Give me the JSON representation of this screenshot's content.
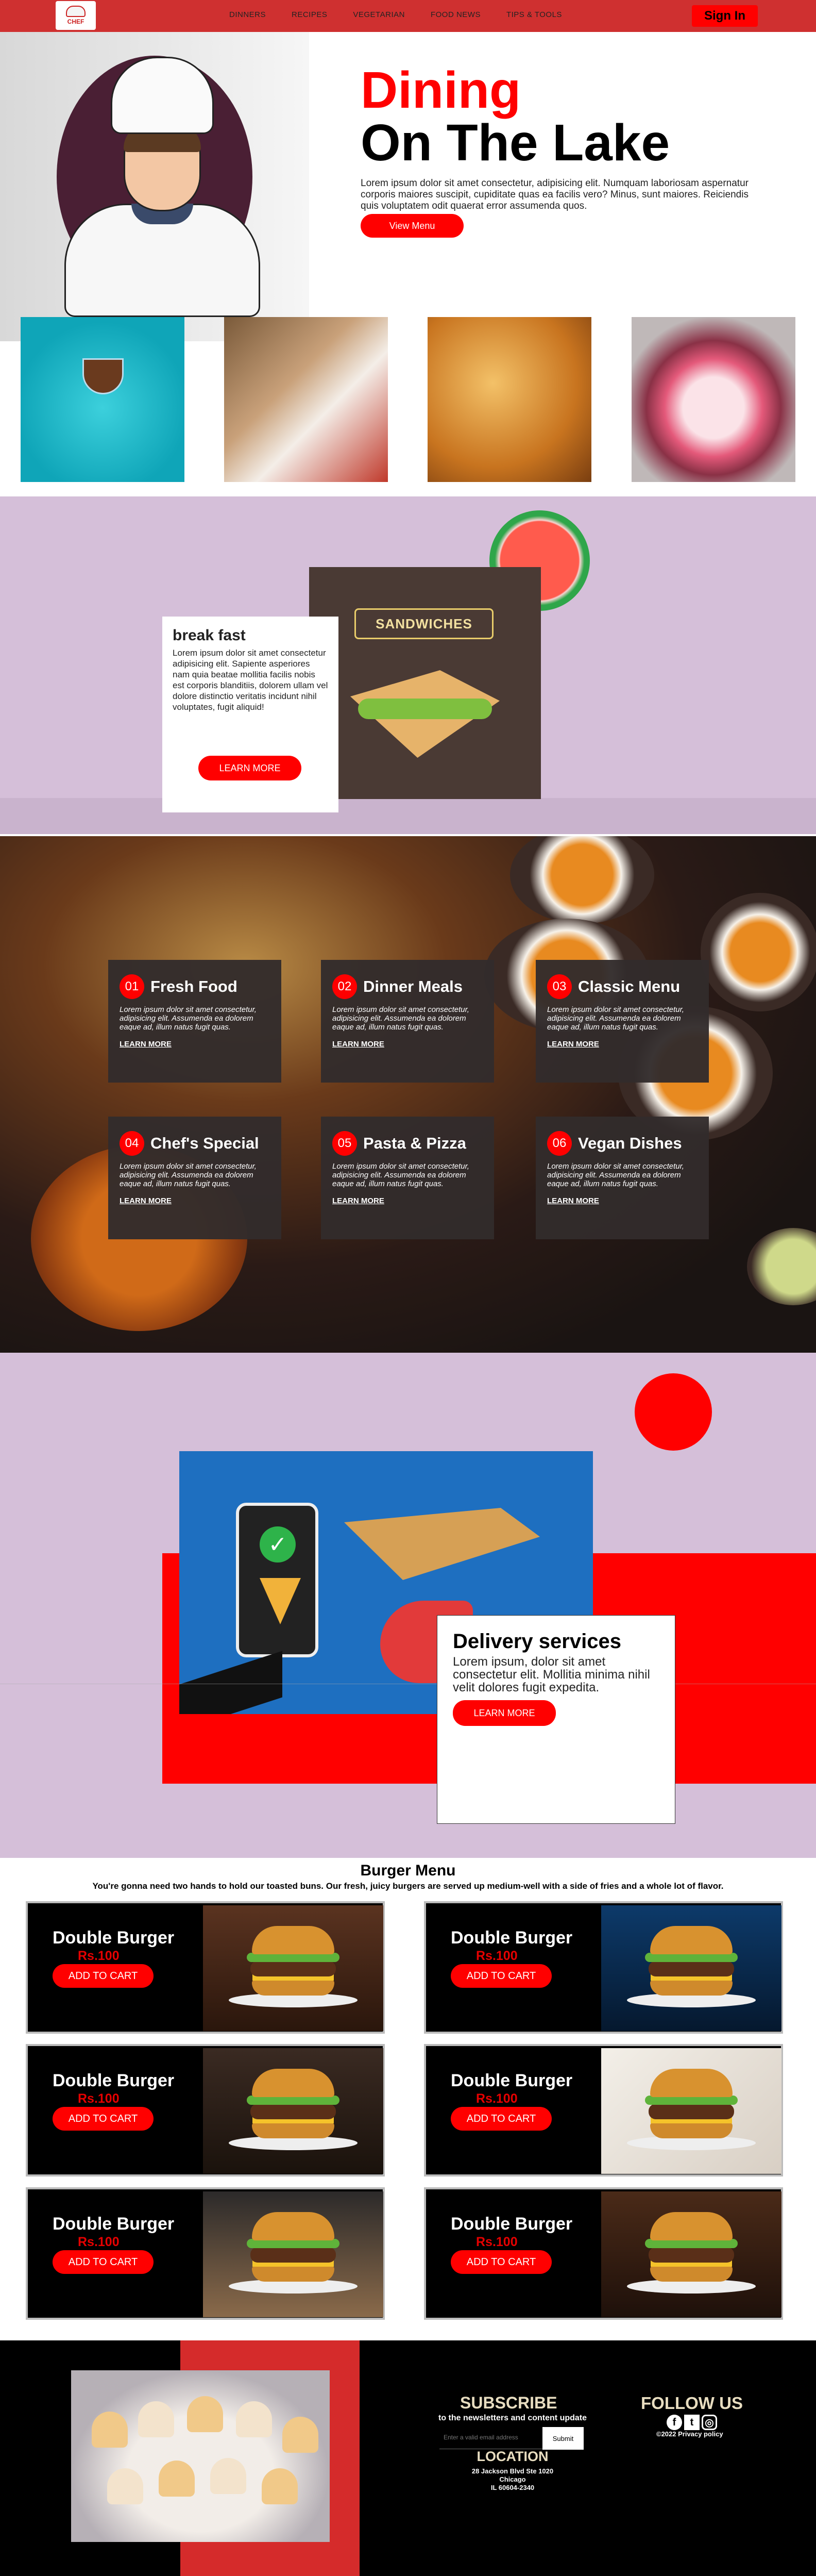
{
  "nav": {
    "logo_text": "CHEF",
    "items": [
      "DINNERS",
      "RECIPES",
      "VEGETARIAN",
      "FOOD NEWS",
      "TIPS & TOOLS"
    ],
    "signin": "Sign In"
  },
  "hero": {
    "title_line1": "Dining",
    "title_line2": "On The Lake",
    "paragraph": "Lorem ipsum dolor sit amet consectetur, adipisicing elit. Numquam laboriosam aspernatur corporis maiores suscipit, cupiditate quas ea facilis vero? Minus, sunt maiores. Reiciendis quis voluptatem odit quaerat error assumenda quos.",
    "button": "View Menu"
  },
  "breakfast": {
    "sandwich_title": "SANDWICHES",
    "title": "break fast",
    "paragraph": "Lorem ipsum dolor sit amet consectetur adipisicing elit. Sapiente asperiores nam quia beatae mollitia facilis nobis est corporis blanditiis, dolorem ullam vel dolore distinctio veritatis incidunt nihil voluptates, fugit aliquid!",
    "button": "LEARN MORE"
  },
  "services": {
    "items": [
      {
        "num": "01",
        "title": "Fresh Food",
        "text": "Lorem ipsum dolor sit amet consectetur, adipisicing elit. Assumenda ea dolorem eaque ad, illum natus fugit quas.",
        "link": "LEARN MORE"
      },
      {
        "num": "02",
        "title": "Dinner Meals",
        "text": "Lorem ipsum dolor sit amet consectetur, adipisicing elit. Assumenda ea dolorem eaque ad, illum natus fugit quas.",
        "link": "LEARN MORE"
      },
      {
        "num": "03",
        "title": "Classic Menu",
        "text": "Lorem ipsum dolor sit amet consectetur, adipisicing elit. Assumenda ea dolorem eaque ad, illum natus fugit quas.",
        "link": "LEARN MORE"
      },
      {
        "num": "04",
        "title": "Chef's Special",
        "text": "Lorem ipsum dolor sit amet consectetur, adipisicing elit. Assumenda ea dolorem eaque ad, illum natus fugit quas.",
        "link": "LEARN MORE"
      },
      {
        "num": "05",
        "title": "Pasta & Pizza",
        "text": "Lorem ipsum dolor sit amet consectetur, adipisicing elit. Assumenda ea dolorem eaque ad, illum natus fugit quas.",
        "link": "LEARN MORE"
      },
      {
        "num": "06",
        "title": "Vegan Dishes",
        "text": "Lorem ipsum dolor sit amet consectetur, adipisicing elit. Assumenda ea dolorem eaque ad, illum natus fugit quas.",
        "link": "LEARN MORE"
      }
    ]
  },
  "delivery": {
    "title": "Delivery services",
    "paragraph": "Lorem ipsum, dolor sit amet consectetur elit. Mollitia minima nihil velit dolores fugit expedita.",
    "button": "LEARN MORE"
  },
  "burger_menu": {
    "title": "Burger Menu",
    "subtitle": "You're gonna need two hands to hold our toasted buns. Our fresh, juicy burgers are served up medium-well with a side of fries and a whole lot of flavor.",
    "items": [
      {
        "name": "Double Burger",
        "price": "Rs.100",
        "button": "ADD TO CART"
      },
      {
        "name": "Double Burger",
        "price": "Rs.100",
        "button": "ADD TO CART"
      },
      {
        "name": "Double Burger",
        "price": "Rs.100",
        "button": "ADD TO CART"
      },
      {
        "name": "Double Burger",
        "price": "Rs.100",
        "button": "ADD TO CART"
      },
      {
        "name": "Double Burger",
        "price": "Rs.100",
        "button": "ADD TO CART"
      },
      {
        "name": "Double Burger",
        "price": "Rs.100",
        "button": "ADD TO CART"
      }
    ]
  },
  "footer": {
    "subscribe_title": "SUBSCRIBE",
    "subscribe_text": "to the newsletters and content update",
    "email_placeholder": "Enter a valid email address",
    "submit": "Submit",
    "location_title": "LOCATION",
    "address": [
      "28 Jackson Blvd Ste 1020",
      "Chicago",
      "IL 60604-2340"
    ],
    "follow_title": "FOLLOW US",
    "copyright": "©2022 Privacy policy"
  },
  "colors": {
    "accent_red": "#ff0000",
    "nav_red": "#cf3030",
    "lavender": "#d5bfd9",
    "dark_card": "#322c2c"
  },
  "icons": [
    "chef-logo-icon",
    "facebook-icon",
    "twitter-icon",
    "instagram-icon",
    "check-icon"
  ]
}
